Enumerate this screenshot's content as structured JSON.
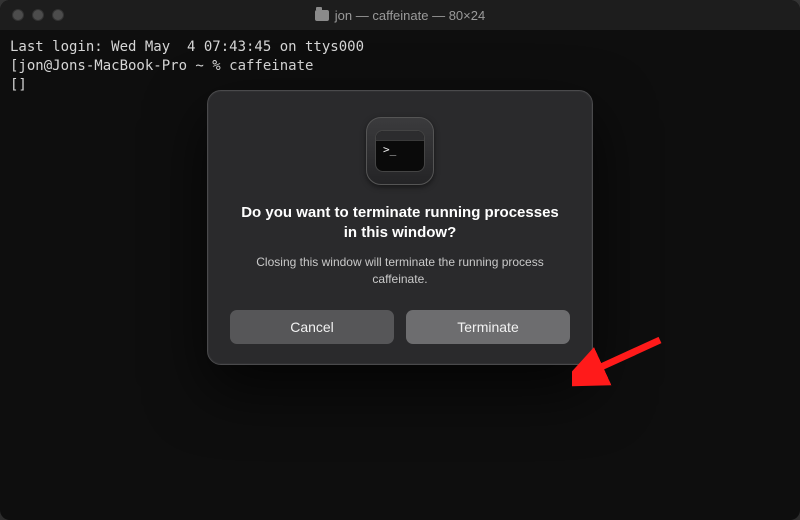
{
  "titlebar": {
    "title": "jon — caffeinate — 80×24"
  },
  "terminal": {
    "line1": "Last login: Wed May  4 07:43:45 on ttys000",
    "line2": "[jon@Jons-MacBook-Pro ~ % caffeinate",
    "line3": "[]"
  },
  "dialog": {
    "icon_prompt": ">_",
    "title": "Do you want to terminate running processes in this window?",
    "message": "Closing this window will terminate the running process caffeinate.",
    "cancel_label": "Cancel",
    "terminate_label": "Terminate"
  }
}
